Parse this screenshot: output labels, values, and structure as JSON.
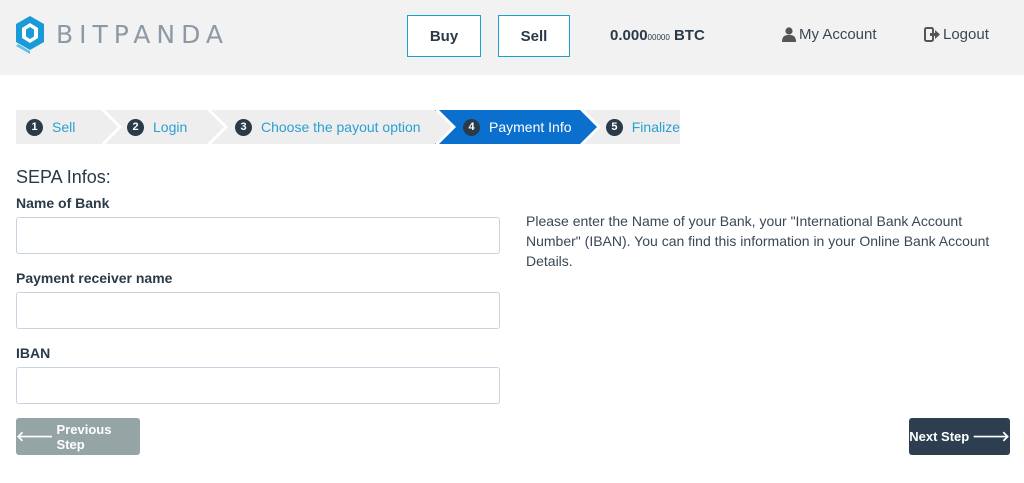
{
  "header": {
    "brand": "BITPANDA",
    "buy_label": "Buy",
    "sell_label": "Sell",
    "balance_main": "0.000",
    "balance_small": "00000",
    "balance_unit": "BTC",
    "my_account_label": "My Account",
    "logout_label": "Logout"
  },
  "steps": [
    {
      "num": "1",
      "label": "Sell",
      "active": false
    },
    {
      "num": "2",
      "label": "Login",
      "active": false
    },
    {
      "num": "3",
      "label": "Choose the payout option",
      "active": false
    },
    {
      "num": "4",
      "label": "Payment Info",
      "active": true
    },
    {
      "num": "5",
      "label": "Finalize",
      "active": false
    }
  ],
  "form": {
    "section_title": "SEPA Infos:",
    "bank_label": "Name of Bank",
    "bank_value": "",
    "receiver_label": "Payment receiver name",
    "receiver_value": "",
    "iban_label": "IBAN",
    "iban_value": "",
    "help_text": "Please enter the Name of your Bank, your \"International Bank Account Number\" (IBAN). You can find this information in your Online Bank Account Details."
  },
  "actions": {
    "prev_label": "Previous Step",
    "next_label": "Next Step"
  },
  "colors": {
    "accent": "#0b6fcd",
    "link": "#2aa0d2",
    "header_bg": "#f2f2f2",
    "dark": "#2c3e50",
    "grey_button": "#95a5a6"
  }
}
